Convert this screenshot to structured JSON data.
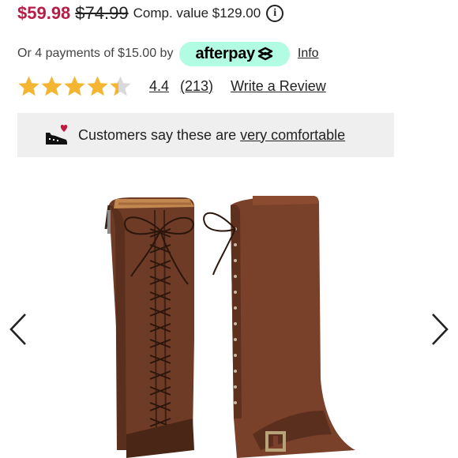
{
  "price": {
    "sale": "$59.98",
    "original": "$74.99",
    "comp_value": "Comp. value $129.00",
    "info_icon": "info-icon"
  },
  "payments": {
    "text": "Or 4 payments of $15.00 by",
    "provider": "afterpay",
    "info_link": "Info"
  },
  "rating": {
    "value": "4.4",
    "count": "(213)",
    "stars": 4.4,
    "write_review": "Write a Review"
  },
  "comfort": {
    "text": "Customers say these are",
    "link": "very comfortable",
    "icon": "shoe-heart-icon"
  },
  "gallery": {
    "prev_icon": "chevron-left-icon",
    "next_icon": "chevron-right-icon",
    "image": "brown lace-up knee-high boots"
  },
  "colors": {
    "sale": "#b71d45",
    "afterpay_bg": "#b2fce4",
    "star": "#f4b532",
    "comfort_bg": "#efefef"
  }
}
